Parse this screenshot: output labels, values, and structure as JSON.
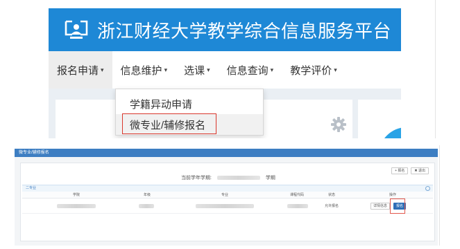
{
  "portal": {
    "title": "浙江财经大学教学综合信息服务平台",
    "nav": [
      {
        "label": "报名申请"
      },
      {
        "label": "信息维护"
      },
      {
        "label": "选课"
      },
      {
        "label": "信息查询"
      },
      {
        "label": "教学评价"
      }
    ],
    "caret": "▾",
    "dropdown": [
      {
        "label": "学籍异动申请"
      },
      {
        "label": "微专业/辅修报名"
      }
    ],
    "colors": {
      "header": "#1e88d6",
      "highlight": "#d9362b"
    },
    "icons": [
      "monitor-person-icon",
      "gear-icon"
    ]
  },
  "app": {
    "title": "微专业/辅修报名",
    "top_buttons": [
      {
        "label": "+ 报名"
      },
      {
        "label": "✖ 退出"
      }
    ],
    "semester_prefix": "当前学年学期:",
    "semester_suffix": "学期",
    "section": "二专业",
    "table": {
      "headers": [
        "学院",
        "年级",
        "专业",
        "课程代码",
        "状态",
        "操作"
      ],
      "rows": [
        {
          "status": "允许报名",
          "actions": [
            {
              "label": "详情信息"
            },
            {
              "label": "报名"
            }
          ]
        }
      ]
    },
    "colors": {
      "titlebar": "#3d7ec2",
      "primary_button": "#2e6fb7"
    }
  }
}
